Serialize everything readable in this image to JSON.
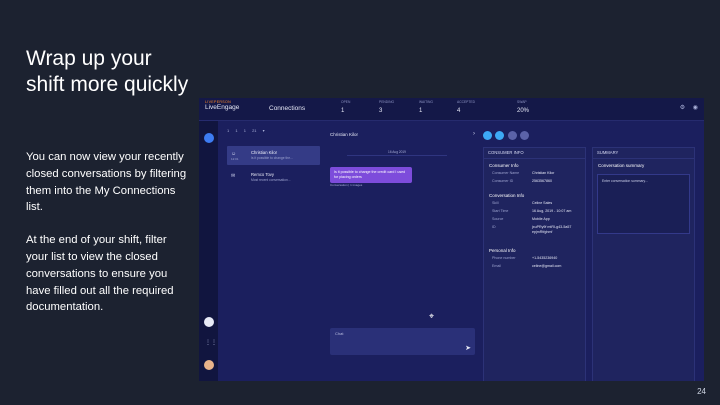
{
  "slide": {
    "title": "Wrap up your shift more quickly",
    "body_1": "You can now view your recently closed conversations by filtering them into the My Connections list.",
    "body_2": "At the end of your shift, filter your list to view the closed conversations to ensure you have filled out all the required documentation.",
    "page_number": "24"
  },
  "app": {
    "brand": "LIVEPERSON",
    "product": "LiveEngage",
    "page_title": "Connections",
    "metrics": [
      {
        "label": "OPEN",
        "value": "1"
      },
      {
        "label": "PENDING",
        "value": "3"
      },
      {
        "label": "WAITING",
        "value": "1"
      },
      {
        "label": "ACCEPTED",
        "value": "4"
      },
      {
        "label": "SWAP",
        "value": "20%"
      }
    ],
    "top_icons": [
      "gear-icon",
      "user-icon"
    ],
    "list_filters": [
      "1",
      "1",
      "1",
      "21",
      "filter"
    ],
    "cards": [
      {
        "name": "Christian Kilor",
        "sub": "Is it possible to change the...",
        "time": "12:01"
      },
      {
        "name": "Remco Tovy",
        "sub": "Most recent conversation...",
        "time": ""
      }
    ],
    "chat": {
      "header": "Christian Kilor",
      "date": "16 Aug 2019",
      "bubble": "Is it possible to change the credit card I used for placing orders",
      "meta": "Conversation | 1 images",
      "composer_placeholder": "Chat"
    },
    "consumer_panel": {
      "header": "CONSUMER INFO",
      "sections": [
        {
          "title": "Consumer Info",
          "rows": [
            {
              "k": "Consumer Name",
              "v": "Christian Kilor"
            },
            {
              "k": "Consumer ID",
              "v": "2563567860"
            }
          ]
        },
        {
          "title": "Conversation Info",
          "rows": [
            {
              "k": "Skill",
              "v": "Celine Sales"
            },
            {
              "k": "Start Time",
              "v": "16 Aug, 2019 - 10:07 am"
            },
            {
              "k": "Source",
              "v": "Mobile App"
            },
            {
              "k": "ID",
              "v": "jxuPRy9f mtRI-g43-5a57 epjmRtfghmf"
            }
          ]
        },
        {
          "title": "Personal Info",
          "rows": [
            {
              "k": "Phone number",
              "v": "+1-5435236940"
            },
            {
              "k": "Email",
              "v": "celine@gmail.com"
            }
          ]
        }
      ]
    },
    "summary_panel": {
      "header": "SUMMARY",
      "section": "Conversation summary",
      "note": "Enter conversation summary..."
    }
  }
}
